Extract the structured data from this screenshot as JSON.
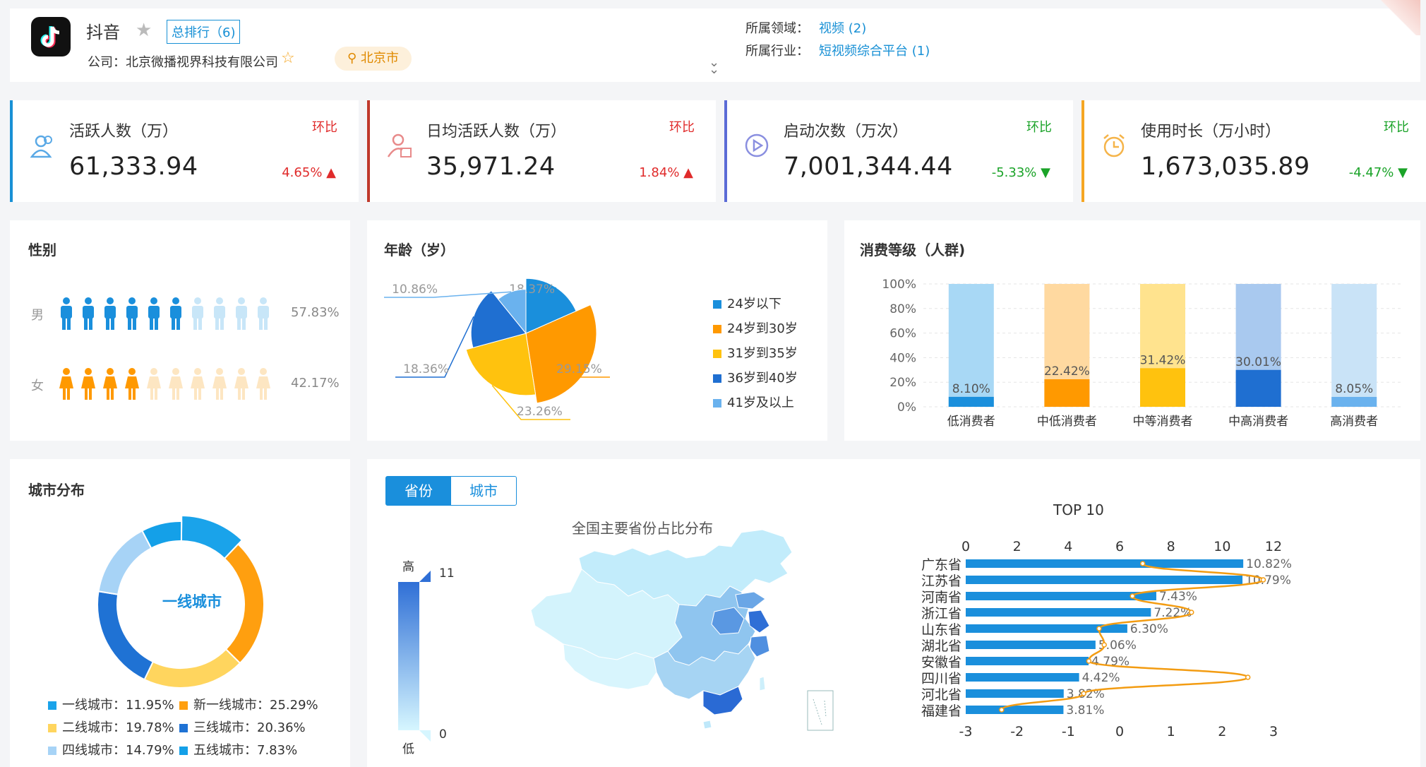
{
  "header": {
    "app_name": "抖音",
    "rank_badge": "总排行（6)",
    "company": "公司：北京微播视界科技有限公司",
    "location": "北京市",
    "field_label": "所属领域：",
    "field_value": "视频 (2)",
    "industry_label": "所属行业：",
    "industry_value": "短视频综合平台 (1)"
  },
  "kpis": [
    {
      "label": "活跃人数（万）",
      "value": "61,333.94",
      "compare": "环比",
      "change": "4.65%",
      "direction": "up",
      "color": "#1890d5"
    },
    {
      "label": "日均活跃人数（万）",
      "value": "35,971.24",
      "compare": "环比",
      "change": "1.84%",
      "direction": "up",
      "color": "#c0392b"
    },
    {
      "label": "启动次数（万次）",
      "value": "7,001,344.44",
      "compare": "环比",
      "change": "-5.33%",
      "direction": "down",
      "color": "#5b6bd6"
    },
    {
      "label": "使用时长（万小时）",
      "value": "1,673,035.89",
      "compare": "环比",
      "change": "-4.47%",
      "direction": "down",
      "color": "#f5a623"
    }
  ],
  "gender": {
    "title": "性别",
    "male_label": "男",
    "male_pct": "57.83%",
    "male_value": 57.83,
    "female_label": "女",
    "female_pct": "42.17%",
    "female_value": 42.17
  },
  "age": {
    "title": "年龄（岁）",
    "legend": [
      "24岁以下",
      "24岁到30岁",
      "31岁到35岁",
      "36岁到40岁",
      "41岁及以上"
    ]
  },
  "consumption": {
    "title": "消费等级（人群)"
  },
  "city": {
    "title": "城市分布",
    "center_label": "一线城市",
    "legend": [
      "一线城市：11.95%",
      "新一线城市：25.29%",
      "二线城市：19.78%",
      "三线城市：20.36%",
      "四线城市：14.79%",
      "五线城市：7.83%"
    ]
  },
  "map_panel": {
    "tab_province": "省份",
    "tab_city": "城市",
    "map_title": "全国主要省份占比分布",
    "scale_high": "高",
    "scale_low": "低",
    "scale_max": "11",
    "scale_min": "0",
    "top_title": "TOP 10"
  },
  "chart_data": [
    {
      "type": "pie",
      "title": "年龄（岁）",
      "categories": [
        "24岁以下",
        "24岁到30岁",
        "31岁到35岁",
        "36岁到40岁",
        "41岁及以上"
      ],
      "values": [
        18.37,
        29.15,
        23.26,
        18.36,
        10.86
      ],
      "labels": [
        "18.37%",
        "29.15%",
        "23.26%",
        "18.36%",
        "10.86%"
      ],
      "colors": [
        "#1a8fdc",
        "#ff9900",
        "#ffc20e",
        "#1f6fd1",
        "#6ab2ee"
      ]
    },
    {
      "type": "bar",
      "title": "消费等级（人群)",
      "categories": [
        "低消费者",
        "中低消费者",
        "中等消费者",
        "中高消费者",
        "高消费者"
      ],
      "values": [
        8.1,
        22.42,
        31.42,
        30.01,
        8.05
      ],
      "labels": [
        "8.10%",
        "22.42%",
        "31.42%",
        "30.01%",
        "8.05%"
      ],
      "yticks": [
        "0%",
        "20%",
        "40%",
        "60%",
        "80%",
        "100%"
      ],
      "ylim": [
        0,
        100
      ],
      "colors": [
        "#1a8fdc",
        "#ff9900",
        "#ffc20e",
        "#1f6fd1",
        "#6ab2ee"
      ],
      "bg_colors": [
        "#a8d8f5",
        "#ffd9a0",
        "#ffe38e",
        "#a9c9ef",
        "#c9e3f7"
      ]
    },
    {
      "type": "pie",
      "title": "城市分布",
      "categories": [
        "一线城市",
        "新一线城市",
        "二线城市",
        "三线城市",
        "四线城市",
        "五线城市"
      ],
      "values": [
        11.95,
        25.29,
        19.78,
        20.36,
        14.79,
        7.83
      ],
      "colors": [
        "#1aa3ea",
        "#ff9f0f",
        "#ffd55e",
        "#1f72d4",
        "#a7d3f6",
        "#14a0e8"
      ]
    },
    {
      "type": "bar",
      "title": "TOP 10",
      "categories": [
        "广东省",
        "江苏省",
        "河南省",
        "浙江省",
        "山东省",
        "湖北省",
        "安徽省",
        "四川省",
        "河北省",
        "福建省"
      ],
      "values": [
        10.82,
        10.79,
        7.43,
        7.22,
        6.3,
        5.06,
        4.79,
        4.42,
        3.82,
        3.81
      ],
      "labels": [
        "10.82%",
        "10.79%",
        "7.43%",
        "7.22%",
        "6.30%",
        "5.06%",
        "4.79%",
        "4.42%",
        "3.82%",
        "3.81%"
      ],
      "xticks_top": [
        "0",
        "2",
        "4",
        "6",
        "8",
        "10",
        "12"
      ],
      "xlim_top": [
        0,
        12
      ],
      "xticks_bottom": [
        "-3",
        "-2",
        "-1",
        "0",
        "1",
        "2",
        "3"
      ],
      "xlim_bottom": [
        -3,
        3
      ],
      "line_values": [
        0.45,
        2.8,
        0.25,
        1.4,
        -0.4,
        -0.3,
        -0.6,
        2.5,
        -0.7,
        -2.3
      ]
    }
  ]
}
